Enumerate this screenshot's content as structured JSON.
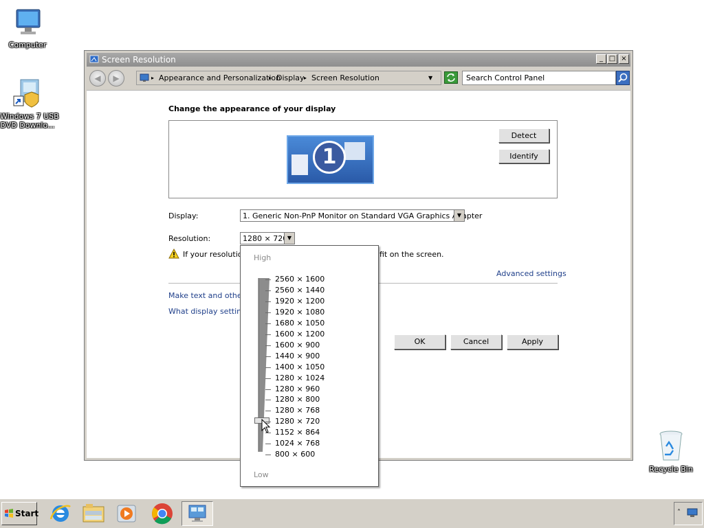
{
  "desktop": {
    "icons": [
      {
        "label": "Computer"
      },
      {
        "label": "Windows 7 USB\nDVD Downlo..."
      },
      {
        "label": "Recycle Bin"
      }
    ]
  },
  "window": {
    "title": "Screen Resolution",
    "controls": {
      "minimize": "_",
      "maximize": "□",
      "close": "×"
    },
    "breadcrumbs": [
      "Appearance and Personalization",
      "Display",
      "Screen Resolution"
    ],
    "search_placeholder": "Search Control Panel"
  },
  "content": {
    "heading": "Change the appearance of your display",
    "monitor_number": "1",
    "detect_label": "Detect",
    "identify_label": "Identify",
    "display_label": "Display:",
    "display_value": "1. Generic Non-PnP Monitor on Standard VGA Graphics Adapter",
    "resolution_label": "Resolution:",
    "resolution_value": "1280 × 720",
    "warning_text_start": "If your resolution",
    "warning_text_end": "fit on the screen.",
    "advanced_settings": "Advanced settings",
    "link_text_size": "Make text and other it",
    "link_display_settings": "What display settings",
    "ok_label": "OK",
    "cancel_label": "Cancel",
    "apply_label": "Apply"
  },
  "resolution_popup": {
    "high_label": "High",
    "low_label": "Low",
    "options": [
      "2560 × 1600",
      "2560 × 1440",
      "1920 × 1200",
      "1920 × 1080",
      "1680 × 1050",
      "1600 × 1200",
      "1600 × 900",
      "1440 × 900",
      "1400 × 1050",
      "1280 × 1024",
      "1280 × 960",
      "1280 × 800",
      "1280 × 768",
      "1280 × 720",
      "1152 × 864",
      "1024 × 768",
      "800 × 600"
    ],
    "selected_index": 13
  },
  "taskbar": {
    "start_label": "Start",
    "apps": [
      "internet-explorer-icon",
      "file-explorer-icon",
      "media-player-icon",
      "chrome-icon",
      "display-settings-icon"
    ]
  },
  "colors": {
    "link": "#1f3f8a",
    "chrome": "#d4d0c8"
  }
}
